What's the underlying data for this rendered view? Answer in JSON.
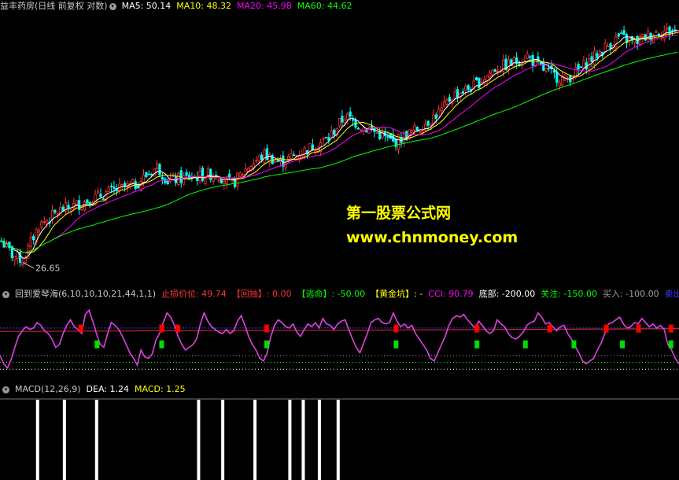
{
  "main_legend": {
    "title": "益丰药房(日线 前复权 对数)",
    "items": [
      {
        "label": "MA5: 50.14",
        "color": "#ffffff"
      },
      {
        "label": "MA10: 48.32",
        "color": "#ffff00"
      },
      {
        "label": "MA20: 45.98",
        "color": "#ff00ff"
      },
      {
        "label": "MA60: 44.62",
        "color": "#00ff00"
      }
    ]
  },
  "low_label": "26.65",
  "mid_legend": {
    "items": [
      {
        "label": "回到爱琴海(6,10,10,10,21,44,1,1)",
        "color": "#c8c8c8"
      },
      {
        "label": "止损价位: 49.74",
        "color": "#ff3232"
      },
      {
        "label": "【回抽】: 0.00",
        "color": "#ff3232"
      },
      {
        "label": "【逃命】: -50.00",
        "color": "#00ff00"
      },
      {
        "label": "【黄金坑】: -",
        "color": "#ffff00"
      },
      {
        "label": "CCI: 90.79",
        "color": "#ff00ff"
      },
      {
        "label": "底部: -200.00",
        "color": "#ffffff"
      },
      {
        "label": "关注: -150.00",
        "color": "#00ff00"
      },
      {
        "label": "买入: -100.00",
        "color": "#a0a0a0"
      },
      {
        "label": "卖出",
        "color": "#3c3cff"
      }
    ]
  },
  "macd_legend": {
    "items": [
      {
        "label": "MACD(12,26,9)",
        "color": "#c8c8c8"
      },
      {
        "label": "DEA: 1.24",
        "color": "#ffffff"
      },
      {
        "label": "MACD: 1.25",
        "color": "#ffff00"
      }
    ]
  },
  "watermark": {
    "line1": "第一股票公式网",
    "line2": "www.chnmoney.com"
  },
  "colors": {
    "up": "#ff3232",
    "down": "#00ffff",
    "bg": "#000000",
    "ma5": "#ffffff",
    "ma10": "#ffff00",
    "ma20": "#ff00ff",
    "ma60": "#00ff00",
    "cci": "#e040e0"
  },
  "chart_data": [
    {
      "type": "candlestick",
      "title": "益丰药房(日线 前复权 对数)",
      "log_scale": true,
      "ylim": [
        25.5,
        54
      ],
      "min_marker": 26.65,
      "ma_latest": {
        "MA5": 50.14,
        "MA10": 48.32,
        "MA20": 45.98,
        "MA60": 44.62
      },
      "price_path": [
        [
          0,
          28.2
        ],
        [
          4,
          27.1
        ],
        [
          8,
          26.65
        ],
        [
          14,
          29.5
        ],
        [
          22,
          30.8
        ],
        [
          30,
          31.5
        ],
        [
          40,
          32.5
        ],
        [
          50,
          33.2
        ],
        [
          58,
          35.0
        ],
        [
          62,
          33.6
        ],
        [
          70,
          33.9
        ],
        [
          80,
          34.3
        ],
        [
          86,
          33.2
        ],
        [
          92,
          35.0
        ],
        [
          98,
          36.2
        ],
        [
          104,
          35.4
        ],
        [
          112,
          36.5
        ],
        [
          122,
          38.0
        ],
        [
          128,
          40.5
        ],
        [
          134,
          39.4
        ],
        [
          140,
          38.6
        ],
        [
          146,
          37.5
        ],
        [
          156,
          39.2
        ],
        [
          164,
          41.2
        ],
        [
          168,
          43.0
        ],
        [
          176,
          44.2
        ],
        [
          184,
          46.5
        ],
        [
          190,
          47.2
        ],
        [
          196,
          48.3
        ],
        [
          200,
          46.8
        ],
        [
          206,
          45.6
        ],
        [
          210,
          45.0
        ],
        [
          214,
          46.0
        ],
        [
          222,
          48.5
        ],
        [
          230,
          51.0
        ],
        [
          236,
          50.2
        ],
        [
          244,
          51.8
        ],
        [
          252,
          52.0
        ]
      ]
    },
    {
      "type": "line",
      "name": "CCI",
      "ylim": [
        -250,
        300
      ],
      "levels": {
        "sell": 100,
        "buy": -100,
        "focus": -150,
        "bottom": -200
      },
      "values": [
        -100,
        -160,
        -190,
        -130,
        -40,
        40,
        80,
        110,
        90,
        100,
        140,
        120,
        80,
        60,
        20,
        -40,
        -20,
        60,
        120,
        160,
        110,
        90,
        60,
        200,
        230,
        150,
        60,
        -20,
        -40,
        60,
        140,
        120,
        90,
        40,
        -20,
        -80,
        -120,
        -170,
        -60,
        -110,
        -120,
        -90,
        10,
        60,
        140,
        210,
        180,
        120,
        40,
        -20,
        -60,
        -40,
        -20,
        20,
        130,
        210,
        150,
        110,
        90,
        70,
        60,
        90,
        60,
        80,
        150,
        190,
        120,
        40,
        -20,
        -60,
        -120,
        -140,
        -80,
        40,
        120,
        160,
        140,
        110,
        100,
        130,
        70,
        40,
        90,
        130,
        110,
        140,
        100,
        170,
        130,
        120,
        90,
        130,
        150,
        160,
        90,
        20,
        -40,
        -80,
        -10,
        60,
        140,
        160,
        170,
        140,
        130,
        140,
        210,
        150,
        110,
        130,
        100,
        120,
        60,
        20,
        -20,
        -60,
        -120,
        -140,
        -80,
        -20,
        40,
        120,
        170,
        190,
        180,
        200,
        160,
        130,
        100,
        150,
        120,
        80,
        60,
        80,
        160,
        130,
        110,
        60,
        30,
        20,
        40,
        70,
        120,
        140,
        150,
        210,
        180,
        130,
        140,
        110,
        80,
        110,
        120,
        60,
        20,
        -30,
        -80,
        -140,
        -160,
        -140,
        -120,
        -60,
        -10,
        60,
        130,
        140,
        160,
        180,
        130,
        100,
        110,
        140,
        130,
        170,
        140,
        110,
        130,
        100,
        120,
        90,
        -20,
        -60,
        -120,
        -160
      ],
      "signals": {
        "red": [
          10,
          20,
          22,
          33,
          49,
          59,
          68,
          75,
          79,
          83
        ],
        "green": [
          12,
          20,
          33,
          49,
          59,
          65,
          71,
          77,
          83
        ]
      }
    },
    {
      "type": "bar",
      "name": "MACD(12,26,9)",
      "latest": {
        "DEA": 1.24,
        "MACD": 1.25
      },
      "signal_bars": [
        14,
        24,
        36,
        74,
        83,
        95,
        108,
        113,
        119,
        126
      ]
    }
  ]
}
